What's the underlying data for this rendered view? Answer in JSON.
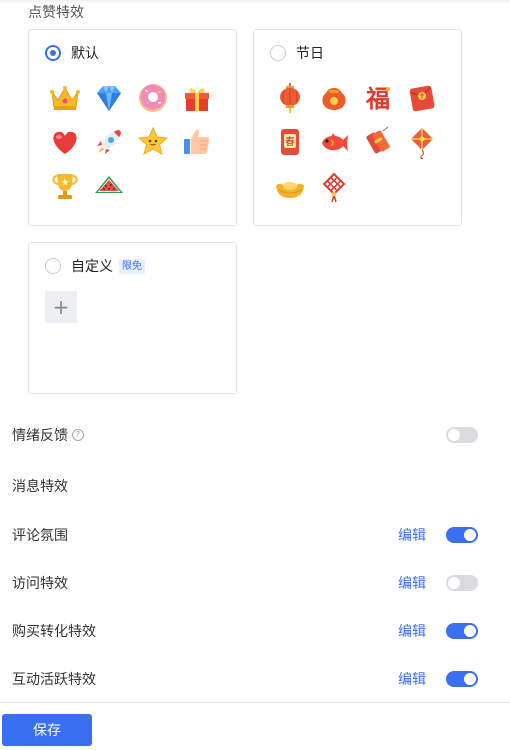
{
  "like_effects": {
    "title": "点赞特效",
    "default_option": {
      "label": "默认",
      "selected": true,
      "icons": [
        "crown-icon",
        "diamond-icon",
        "donut-icon",
        "gift-icon",
        "heart-icon",
        "rocket-icon",
        "star-icon",
        "thumbs-up-icon",
        "trophy-icon",
        "watermelon-icon"
      ]
    },
    "festival_option": {
      "label": "节日",
      "selected": false,
      "icons": [
        "lantern-icon",
        "lucky-bag-icon",
        "fu-character-icon",
        "red-envelope-icon",
        "spring-couplet-icon",
        "koi-fish-icon",
        "firecracker-icon",
        "kite-icon",
        "gold-ingot-icon",
        "chinese-knot-icon"
      ],
      "fu_char": "福",
      "chun_char": "春"
    },
    "custom_option": {
      "label": "自定义",
      "tag": "限免",
      "selected": false,
      "add_symbol": "+"
    }
  },
  "settings": {
    "emotion_feedback": {
      "label": "情绪反馈",
      "help_symbol": "?",
      "enabled": false
    },
    "message_effects": {
      "label": "消息特效"
    },
    "comment_atmosphere": {
      "label": "评论氛围",
      "edit_label": "编辑",
      "enabled": true
    },
    "visit_effects": {
      "label": "访问特效",
      "edit_label": "编辑",
      "enabled": false
    },
    "purchase_conversion": {
      "label": "购买转化特效",
      "edit_label": "编辑",
      "enabled": true
    },
    "interaction_active": {
      "label": "互动活跃特效",
      "edit_label": "编辑",
      "enabled": true
    }
  },
  "footer": {
    "save_label": "保存"
  },
  "colors": {
    "accent": "#3a6ff2",
    "switch_off": "#d9dbdf",
    "border": "#e3e5e8"
  }
}
